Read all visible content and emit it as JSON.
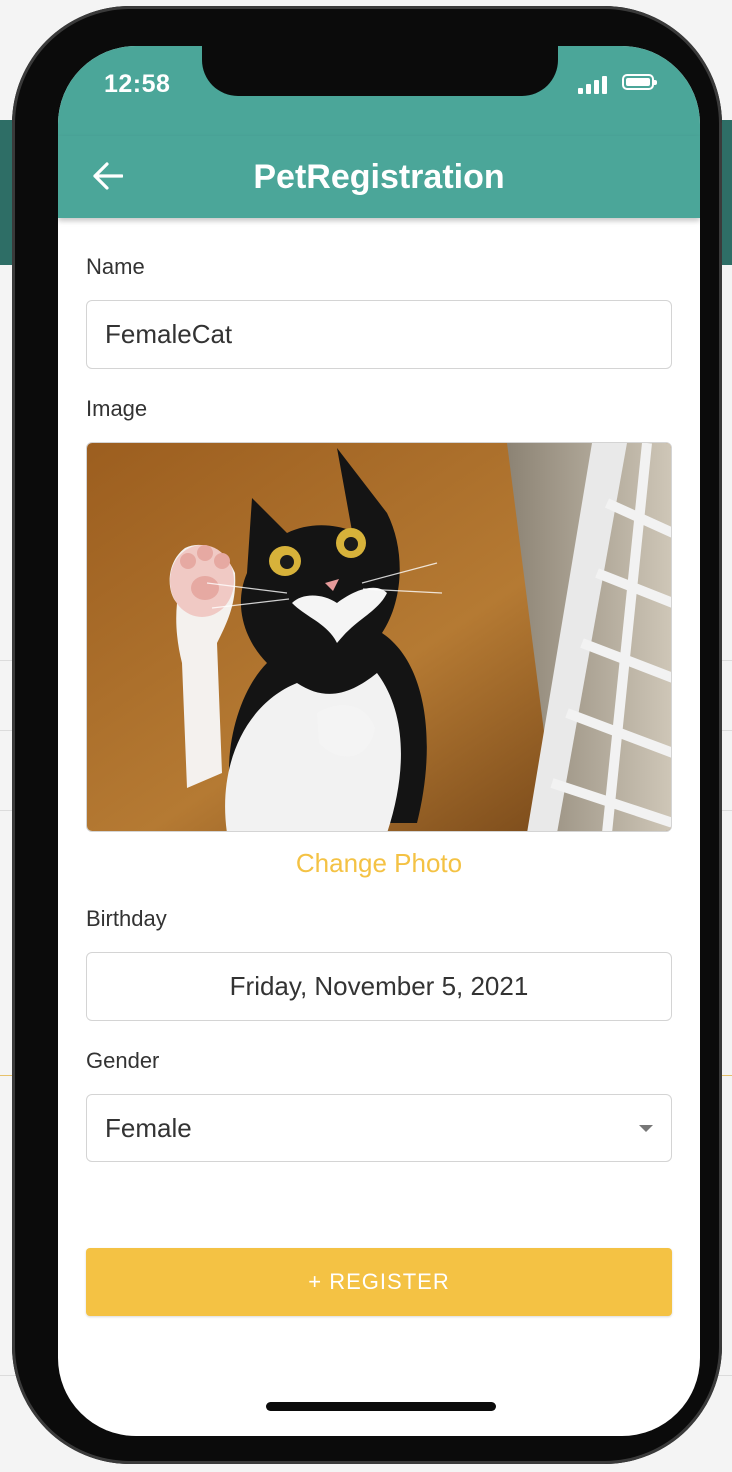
{
  "status_bar": {
    "time": "12:58"
  },
  "app_bar": {
    "title": "PetRegistration",
    "back_icon": "arrow-left-icon"
  },
  "form": {
    "name_label": "Name",
    "name_value": "FemaleCat",
    "image_label": "Image",
    "image_icon": "cat-photo",
    "change_photo_label": "Change Photo",
    "birthday_label": "Birthday",
    "birthday_value": "Friday, November 5, 2021",
    "gender_label": "Gender",
    "gender_value": "Female",
    "register_label": "+ REGISTER"
  },
  "colors": {
    "primary": "#4ba699",
    "accent": "#f4c244"
  }
}
